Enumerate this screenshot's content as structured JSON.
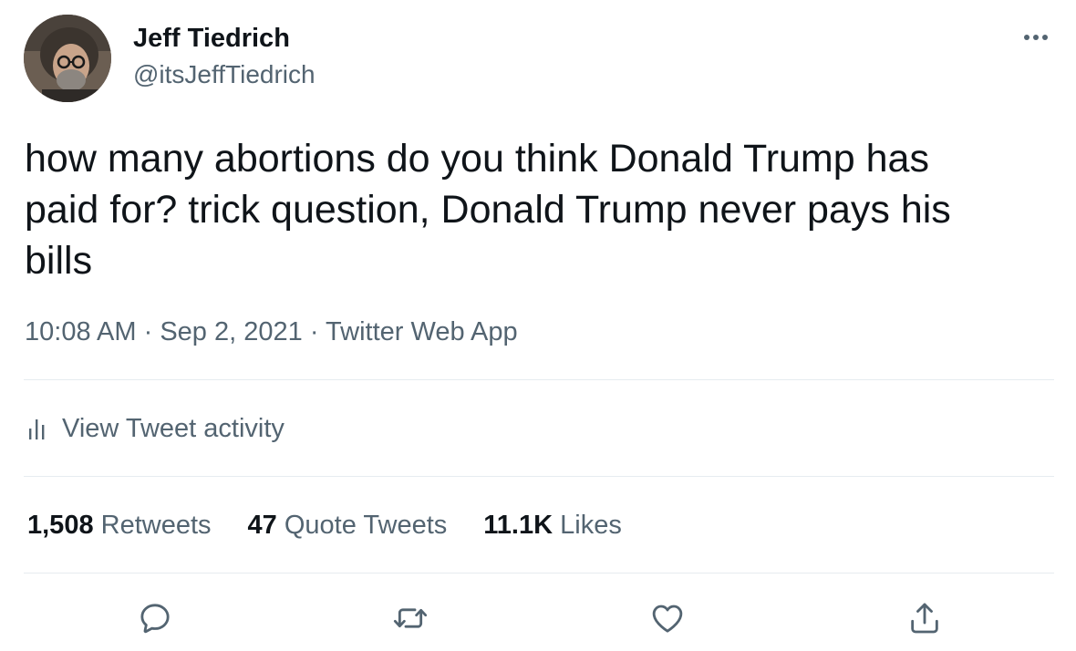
{
  "author": {
    "display_name": "Jeff Tiedrich",
    "handle": "@itsJeffTiedrich"
  },
  "tweet": {
    "text": "how many abortions do you think Donald Trump has\npaid for? trick question, Donald Trump never pays his\nbills"
  },
  "meta": {
    "time": "10:08 AM",
    "separator": "·",
    "date": "Sep 2, 2021",
    "source": "Twitter Web App"
  },
  "activity": {
    "label": "View Tweet activity"
  },
  "stats": {
    "retweets": {
      "count": "1,508",
      "label": "Retweets"
    },
    "quotes": {
      "count": "47",
      "label": "Quote Tweets"
    },
    "likes": {
      "count": "11.1K",
      "label": "Likes"
    }
  },
  "icons": {
    "more": "more-horizontal-icon",
    "activity": "bar-chart-icon",
    "reply": "speech-bubble-icon",
    "retweet": "retweet-icon",
    "like": "heart-icon",
    "share": "share-icon"
  },
  "colors": {
    "text_primary": "#0f1419",
    "text_secondary": "#536471",
    "divider": "#e6ecf0"
  }
}
